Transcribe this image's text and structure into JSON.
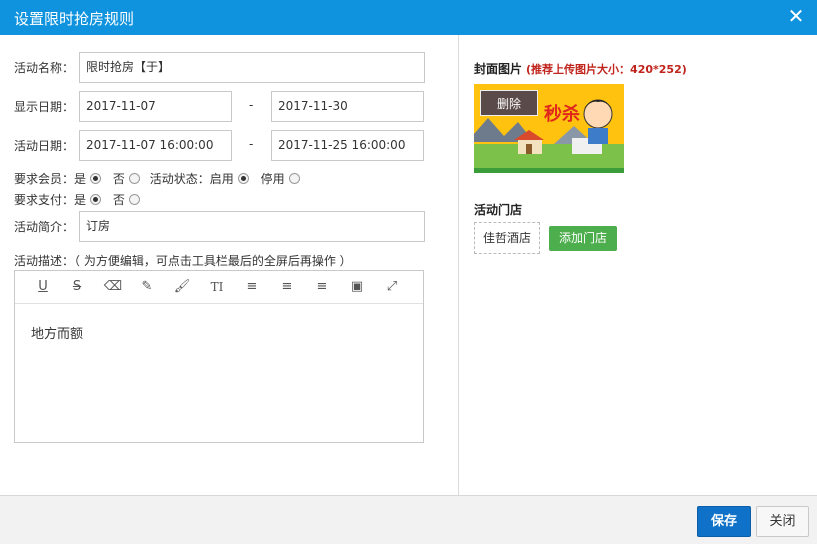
{
  "dialog": {
    "title": "设置限时抢房规则"
  },
  "form": {
    "name_label": "活动名称：",
    "name_value": "限时抢房【于】",
    "display_date_label": "显示日期：",
    "display_start": "2017-11-07",
    "display_end": "2017-11-30",
    "activity_date_label": "活动日期：",
    "activity_start": "2017-11-07 16:00:00",
    "activity_end": "2017-11-25 16:00:00",
    "range_sep": "-",
    "member_label": "要求会员：",
    "yes": "是",
    "no": "否",
    "status_label": "活动状态：",
    "status_on": "启用",
    "status_off": "停用",
    "payment_label": "要求支付：",
    "intro_label": "活动简介：",
    "intro_value": "订房",
    "desc_label": "活动描述：（ 为方便编辑，可点击工具栏最后的全屏后再操作 ）",
    "desc_content": "地方而额"
  },
  "editor_tools": [
    {
      "icon": "underline-icon",
      "glyph": "U"
    },
    {
      "icon": "strikethrough-icon",
      "glyph": "S"
    },
    {
      "icon": "eraser-icon",
      "glyph": "⌫"
    },
    {
      "icon": "pencil-icon",
      "glyph": "✎"
    },
    {
      "icon": "brush-icon",
      "glyph": "🖌"
    },
    {
      "icon": "text-size-icon",
      "glyph": "TI"
    },
    {
      "icon": "align-left-icon",
      "glyph": "≡"
    },
    {
      "icon": "align-center-icon",
      "glyph": "≡"
    },
    {
      "icon": "align-right-icon",
      "glyph": "≡"
    },
    {
      "icon": "image-icon",
      "glyph": "▣"
    },
    {
      "icon": "fullscreen-icon",
      "glyph": "⤢"
    }
  ],
  "cover": {
    "title": "封面图片",
    "hint": "(推荐上传图片大小：420*252)",
    "delete_label": "删除"
  },
  "stores": {
    "title": "活动门店",
    "items": [
      "佳哲酒店"
    ],
    "add_label": "添加门店"
  },
  "footer": {
    "save_label": "保存",
    "close_label": "关闭"
  },
  "colors": {
    "titlebar": "#0f93de",
    "save": "#0f72c8",
    "add_store": "#4cae4c",
    "hint": "#c0241c"
  }
}
